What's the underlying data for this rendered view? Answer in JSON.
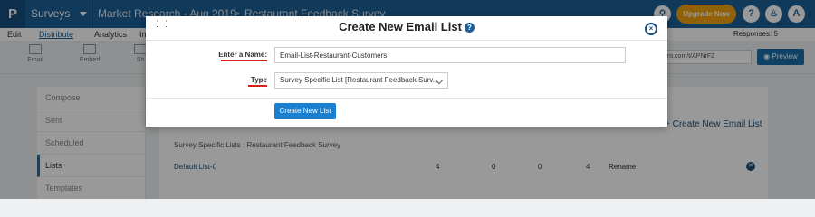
{
  "header": {
    "logo_letter": "P",
    "product": "Surveys",
    "breadcrumb_survey": "Market Research - Aug 2019",
    "breadcrumb_sep": ">",
    "breadcrumb_page": "Restaurant Feedback Survey",
    "search_icon": "search-icon",
    "upgrade_label": "Upgrade Now",
    "help_label": "?",
    "avatar_label": "A"
  },
  "menu": {
    "items": [
      "Edit",
      "Distribute",
      "Analytics",
      "Inte"
    ],
    "active": "Distribute",
    "responses": "Responses: 5"
  },
  "toolbar": {
    "tools": [
      "Email",
      "Embed",
      "Sh"
    ],
    "url_text": "pro.com/t/APNrFZ",
    "preview_label": "Preview"
  },
  "sidebar": {
    "items": [
      "Compose",
      "Sent",
      "Scheduled",
      "Lists",
      "Templates"
    ],
    "active": "Lists"
  },
  "main": {
    "create_link": "Create New Email List",
    "section_label": "Survey Specific Lists : Restaurant Feedback Survey",
    "rows": [
      {
        "name": "Default List-0",
        "c1": "4",
        "c2": "0",
        "c3": "0",
        "c4": "4",
        "action": "Rename"
      }
    ]
  },
  "modal": {
    "title": "Create New Email List",
    "help_icon": "?",
    "close_icon": "×",
    "name_label": "Enter a Name:",
    "name_value": "Email-List-Restaurant-Customers",
    "type_label": "Type",
    "type_value": "Survey Specific List [Restaurant Feedback Surv...",
    "submit_label": "Create New List"
  },
  "colors": {
    "header_bg": "#1b5f96",
    "upgrade": "#f2a20f",
    "primary_button": "#1b7fd0",
    "required_underline": "#d6201c"
  }
}
